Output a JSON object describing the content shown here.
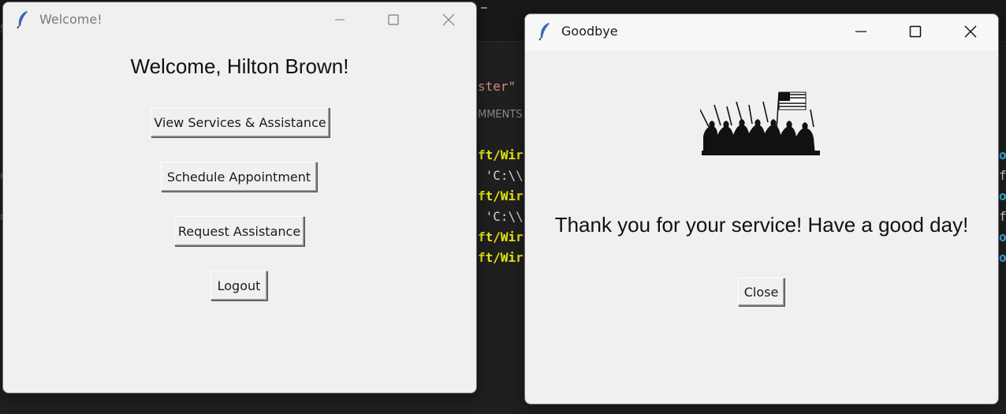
{
  "editor": {
    "breadcrumb": "…",
    "code_lines": [
      {
        "text": "ster\"",
        "color": "orange"
      },
      {
        "text": "MMENTS",
        "color": "label"
      },
      {
        "text": "ft/Wir",
        "color": "yellow"
      },
      {
        "text": " 'C:\\\\",
        "color": "white"
      },
      {
        "text": "ft/Wir",
        "color": "yellow"
      },
      {
        "text": " 'C:\\\\",
        "color": "white"
      },
      {
        "text": "ft/Wir",
        "color": "yellow"
      },
      {
        "text": "ft/Wir",
        "color": "yellow"
      }
    ]
  },
  "welcome_window": {
    "title": "Welcome!",
    "heading": "Welcome, Hilton Brown!",
    "buttons": {
      "view_services": "View Services & Assistance",
      "schedule": "Schedule Appointment",
      "request": "Request Assistance",
      "logout": "Logout"
    },
    "title_color": "#7a7a7a"
  },
  "goodbye_window": {
    "title": "Goodbye",
    "message": "Thank you for your service! Have a good day!",
    "close_button": "Close",
    "image_icon": "soldiers-flag-silhouette",
    "title_color": "#1a1a1a"
  },
  "colors": {
    "window_bg": "#f0f0f0",
    "editor_bg": "#1f1f1f"
  }
}
